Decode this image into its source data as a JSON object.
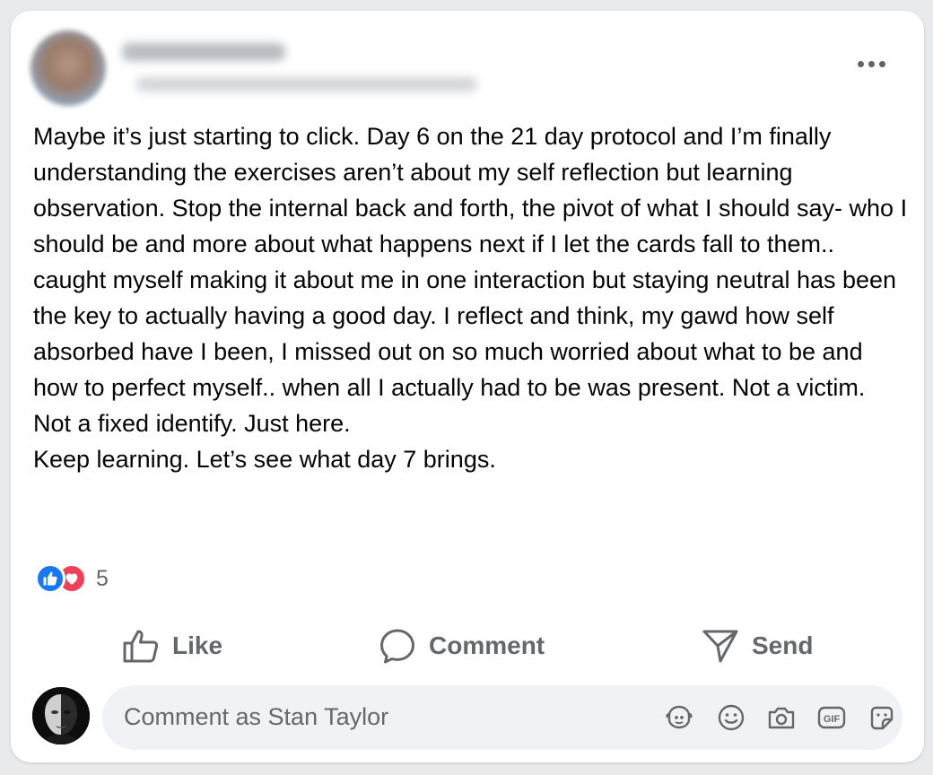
{
  "post": {
    "paragraphs": [
      "Maybe it’s just starting to click. Day 6 on the 21 day protocol and I’m finally understanding the exercises aren’t about my self reflection but learning observation. Stop the internal back and forth, the pivot of what I should say- who I should be and more about what happens next if I let the cards fall to them..",
      "caught myself making it about me in one interaction but staying neutral has been the key to actually having a good day. I reflect and think, my gawd how self absorbed have I been, I missed out on so much worried about what to be and how to perfect myself.. when all I actually had to be was present. Not a victim. Not a fixed identify. Just here.",
      "Keep learning. Let’s see what day 7 brings."
    ],
    "reaction_count": "5",
    "reaction_icons": [
      "like-icon",
      "love-icon"
    ]
  },
  "actions": {
    "like_label": "Like",
    "comment_label": "Comment",
    "send_label": "Send"
  },
  "composer": {
    "placeholder": "Comment as Stan Taylor",
    "icons": [
      "avatar-sticker-icon",
      "emoji-icon",
      "camera-icon",
      "gif-icon",
      "sticker-icon"
    ]
  },
  "colors": {
    "like_blue": "#1877f2",
    "love_red": "#f33e58",
    "secondary_text": "#65676b",
    "composer_bg": "#f0f2f5"
  }
}
